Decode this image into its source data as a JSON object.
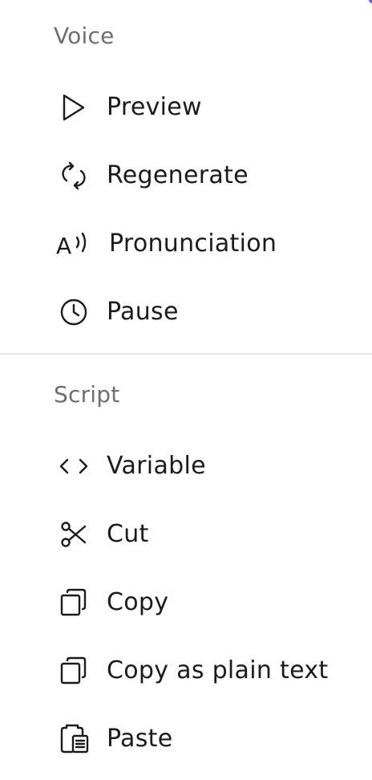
{
  "menu": {
    "sections": [
      {
        "title": "Voice",
        "items": [
          {
            "label": "Preview",
            "icon": "play-icon"
          },
          {
            "label": "Regenerate",
            "icon": "regenerate-icon"
          },
          {
            "label": "Pronunciation",
            "icon": "pronunciation-icon"
          },
          {
            "label": "Pause",
            "icon": "clock-icon"
          }
        ]
      },
      {
        "title": "Script",
        "items": [
          {
            "label": "Variable",
            "icon": "code-brackets-icon"
          },
          {
            "label": "Cut",
            "icon": "scissors-icon"
          },
          {
            "label": "Copy",
            "icon": "copy-icon"
          },
          {
            "label": "Copy as plain text",
            "icon": "copy-icon"
          },
          {
            "label": "Paste",
            "icon": "clipboard-icon"
          }
        ]
      }
    ]
  },
  "colors": {
    "text": "#1b1b1b",
    "section_label": "#6e6e6e",
    "divider": "#e6e6e6",
    "accent": "#6a5acd"
  },
  "icon_glyphs": {
    "pronunciation_letter": "A"
  }
}
